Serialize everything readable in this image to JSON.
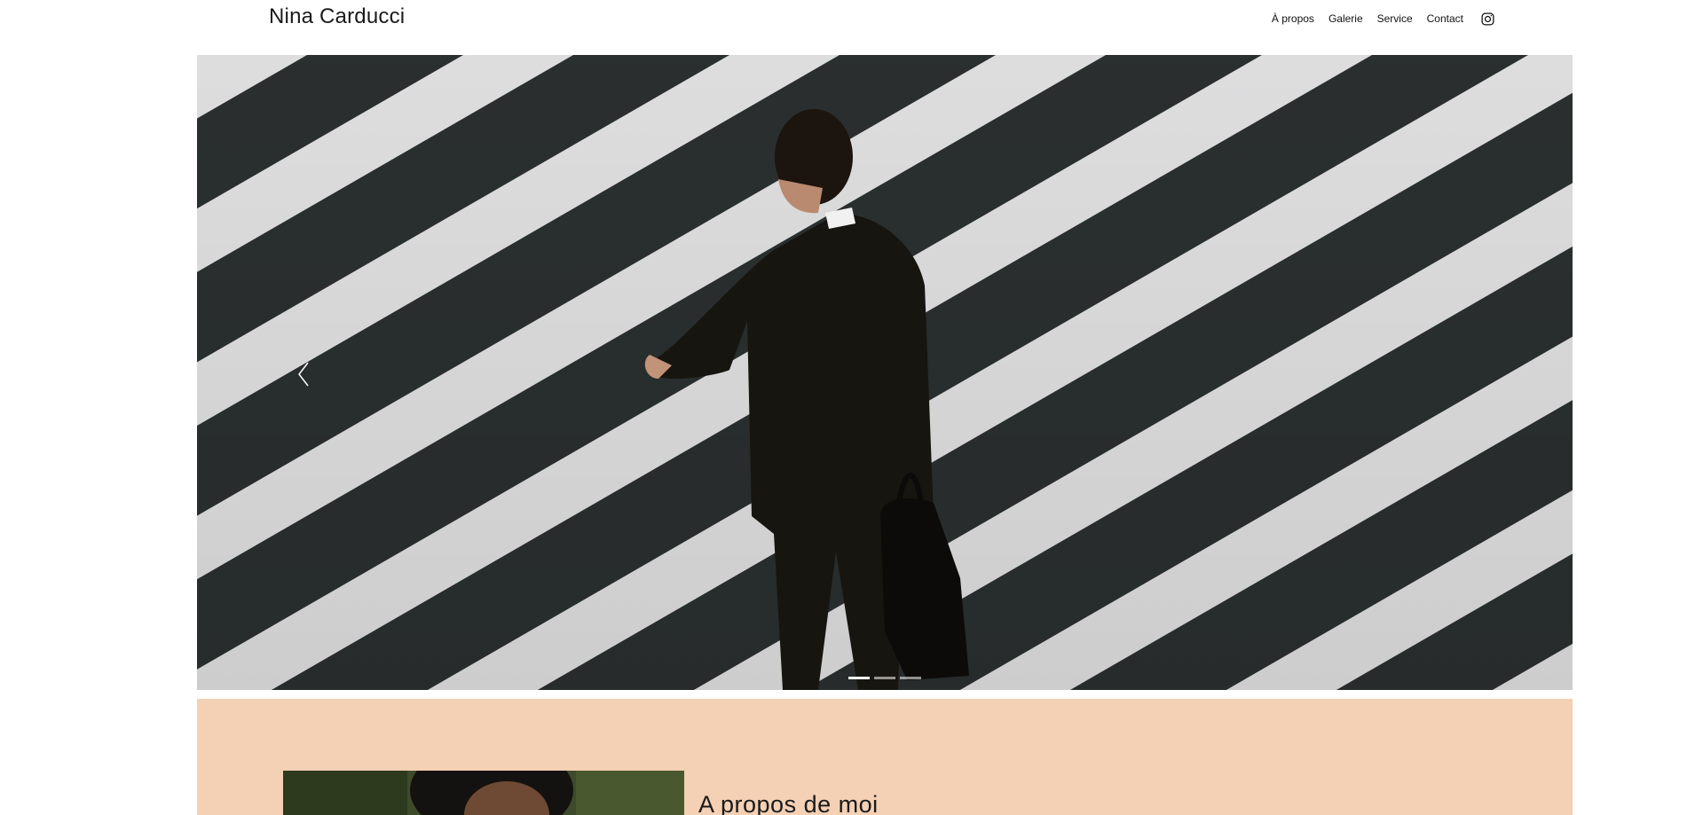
{
  "header": {
    "brand": "Nina Carducci",
    "nav": [
      {
        "label": "À propos"
      },
      {
        "label": "Galerie"
      },
      {
        "label": "Service"
      },
      {
        "label": "Contact"
      }
    ],
    "social_icon": "instagram-icon"
  },
  "hero": {
    "slides_total": 3,
    "active_slide": 1,
    "prev_icon": "chevron-left-icon"
  },
  "about": {
    "title": "A propos de moi",
    "background": "#f4d0b4"
  }
}
